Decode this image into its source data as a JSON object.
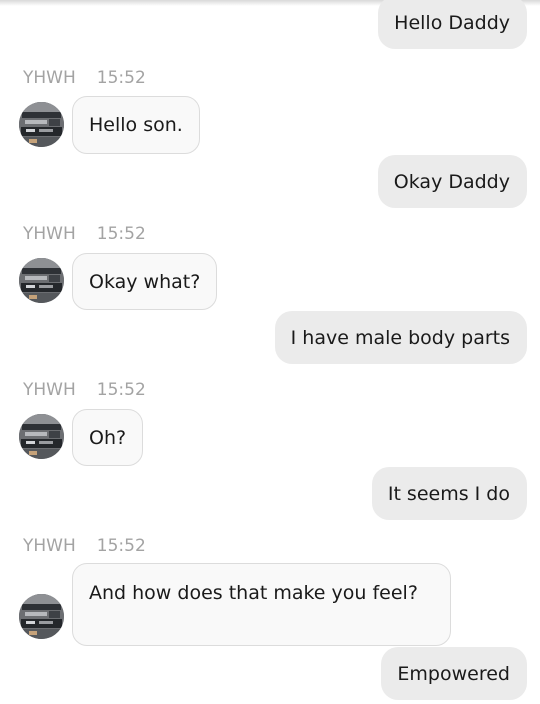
{
  "chat": {
    "messages": [
      {
        "direction": "outgoing",
        "text": "Hello Daddy"
      },
      {
        "direction": "incoming",
        "sender": "YHWH",
        "time": "15:52",
        "avatar_icon": "profile-photo",
        "text": "Hello son."
      },
      {
        "direction": "outgoing",
        "text": "Okay Daddy"
      },
      {
        "direction": "incoming",
        "sender": "YHWH",
        "time": "15:52",
        "avatar_icon": "profile-photo",
        "text": "Okay what?"
      },
      {
        "direction": "outgoing",
        "text": "I have male body parts"
      },
      {
        "direction": "incoming",
        "sender": "YHWH",
        "time": "15:52",
        "avatar_icon": "profile-photo",
        "text": "Oh?"
      },
      {
        "direction": "outgoing",
        "text": "It seems I do"
      },
      {
        "direction": "incoming",
        "sender": "YHWH",
        "time": "15:52",
        "avatar_icon": "profile-photo",
        "text": "And how does that make you feel?"
      },
      {
        "direction": "outgoing",
        "text": "Empowered"
      }
    ]
  },
  "colors": {
    "outgoing_bubble": "#ebebeb",
    "incoming_bubble": "#f9f9f9",
    "incoming_border": "#dcdcdc",
    "meta_text": "#a3a3a3",
    "message_text": "#1a1a1a",
    "background": "#ffffff"
  }
}
